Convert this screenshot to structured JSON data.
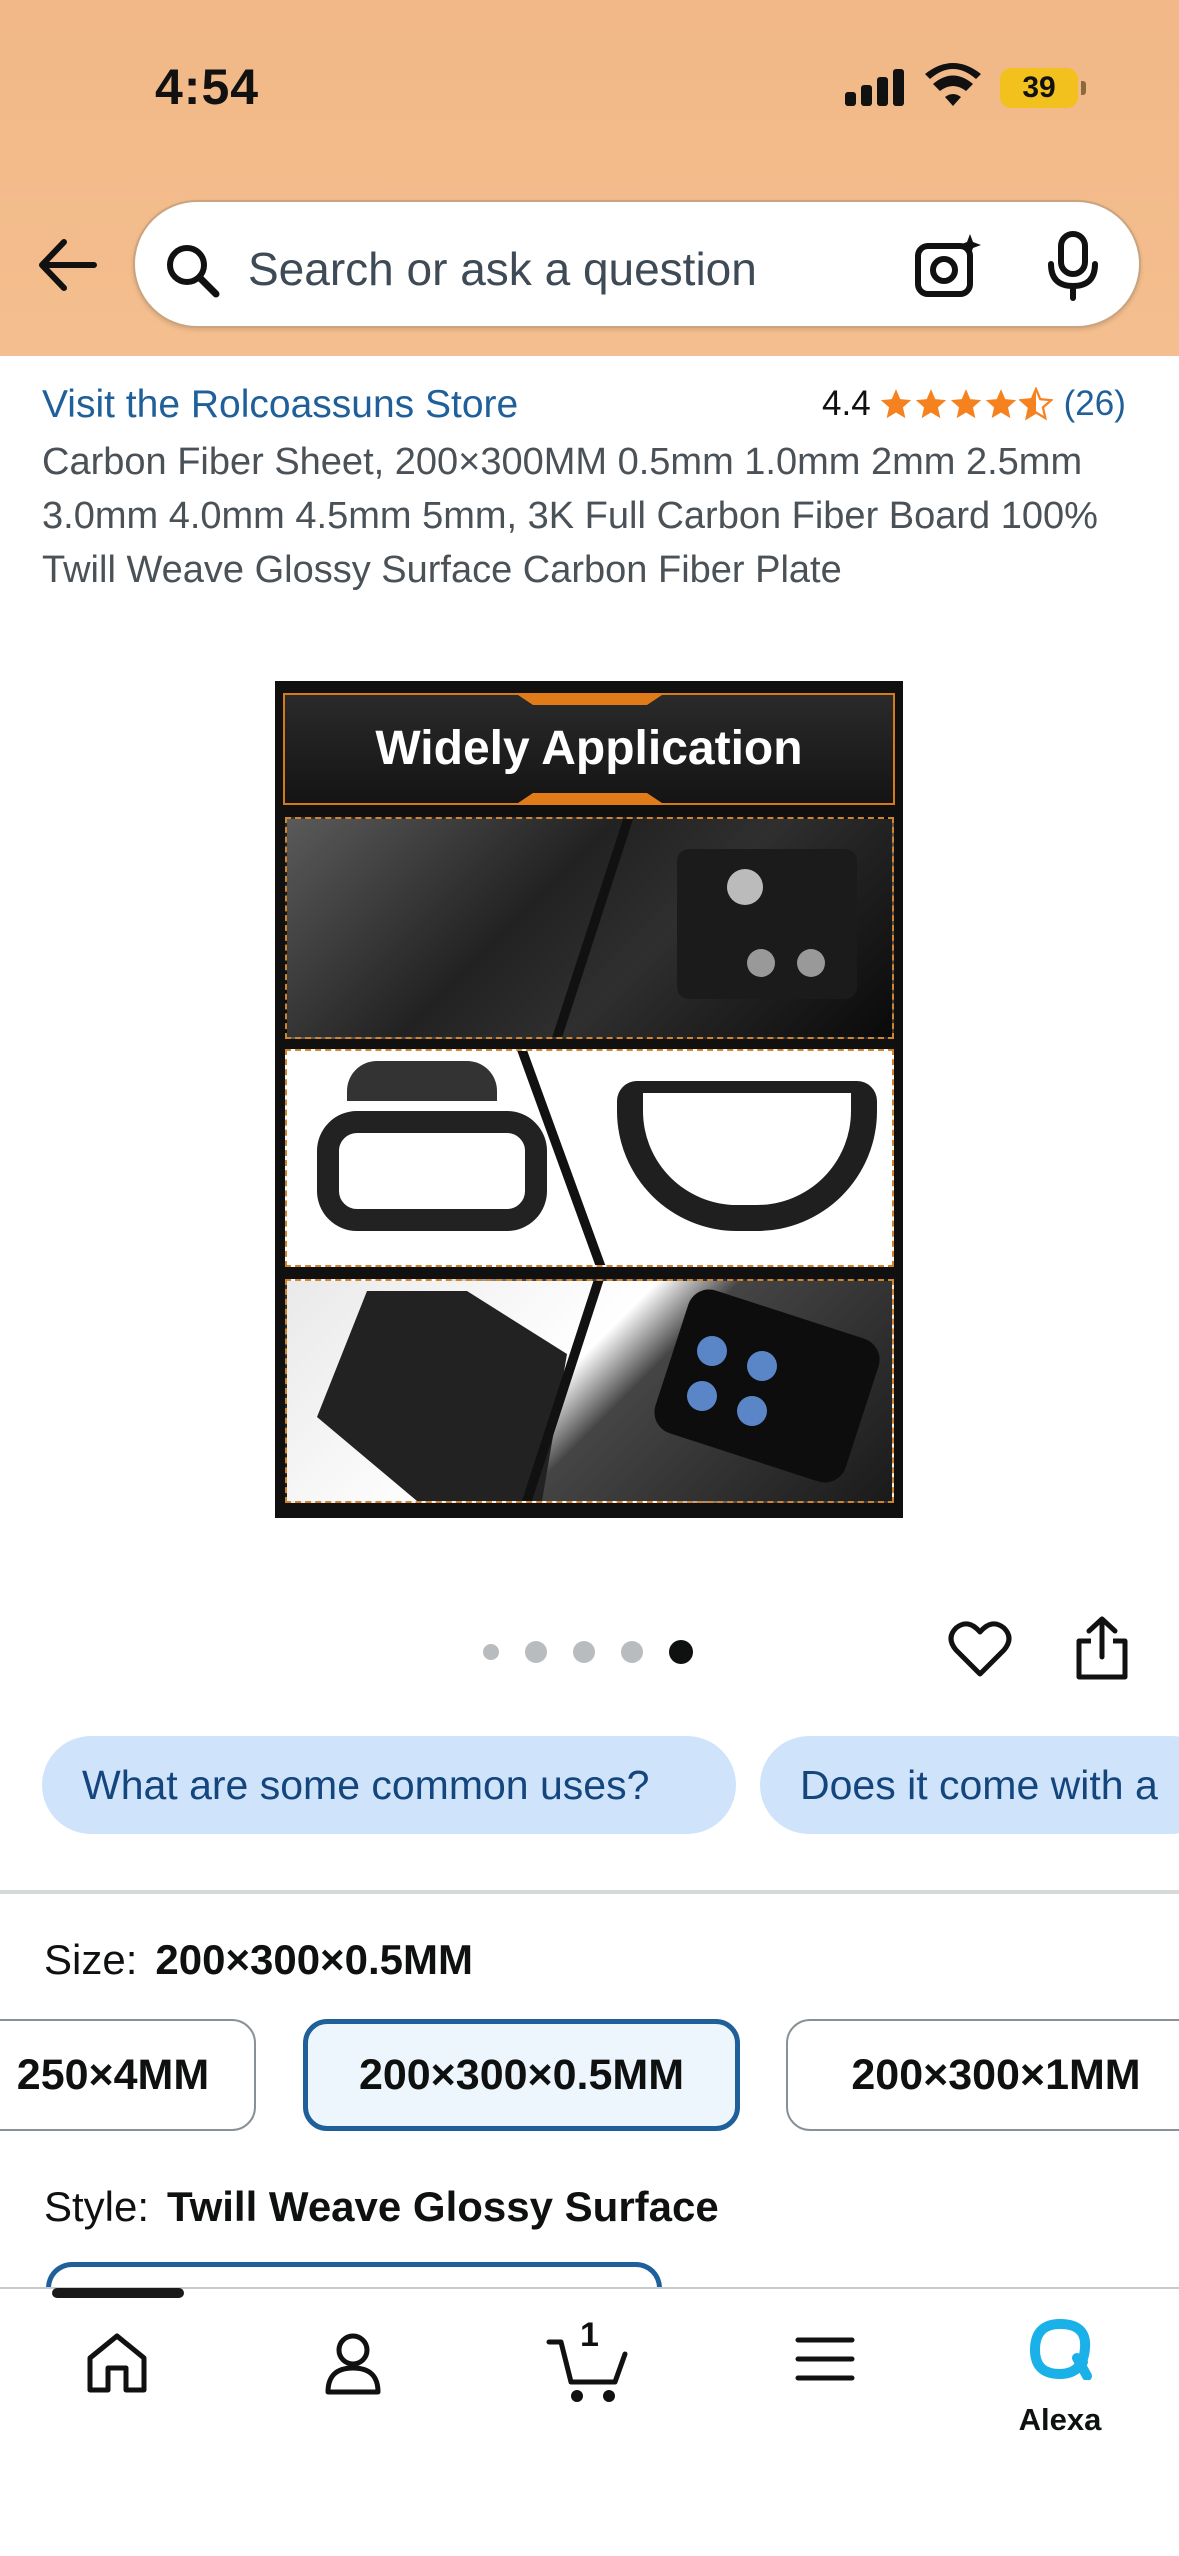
{
  "status_bar": {
    "time": "4:54",
    "battery": "39"
  },
  "search": {
    "placeholder": "Search or ask a question"
  },
  "product": {
    "store_link": "Visit the Rolcoassuns Store",
    "rating": "4.4",
    "stars_filled": 4.4,
    "review_count": "(26)",
    "title": "Carbon Fiber Sheet, 200×300MM 0.5mm 1.0mm 2mm 2.5mm 3.0mm 4.0mm 4.5mm 5mm, 3K Full Carbon Fiber Board 100% Twill Weave Glossy Surface Carbon Fiber Plate",
    "image_banner": "Widely Application",
    "image_count": 5,
    "image_index": 5
  },
  "questions": [
    "What are some common uses?",
    "Does it come with a"
  ],
  "size": {
    "label": "Size:",
    "selected": "200×300×0.5MM",
    "options": [
      "250×4MM",
      "200×300×0.5MM",
      "200×300×1MM"
    ]
  },
  "style": {
    "label": "Style:",
    "selected": "Twill Weave Glossy Surface"
  },
  "tabbar": {
    "cart_count": "1",
    "alexa_label": "Alexa"
  },
  "colors": {
    "header_bg": "#f2b887",
    "link": "#1f5f9a",
    "star": "#f5821f",
    "chip_bg": "#cfe4fb",
    "selected_border": "#1f5f9a",
    "alexa": "#1ab1e8"
  },
  "icons": [
    "back-arrow-icon",
    "search-icon",
    "camera-icon",
    "mic-icon",
    "heart-icon",
    "share-icon",
    "home-icon",
    "account-icon",
    "cart-icon",
    "menu-icon",
    "alexa-icon"
  ]
}
